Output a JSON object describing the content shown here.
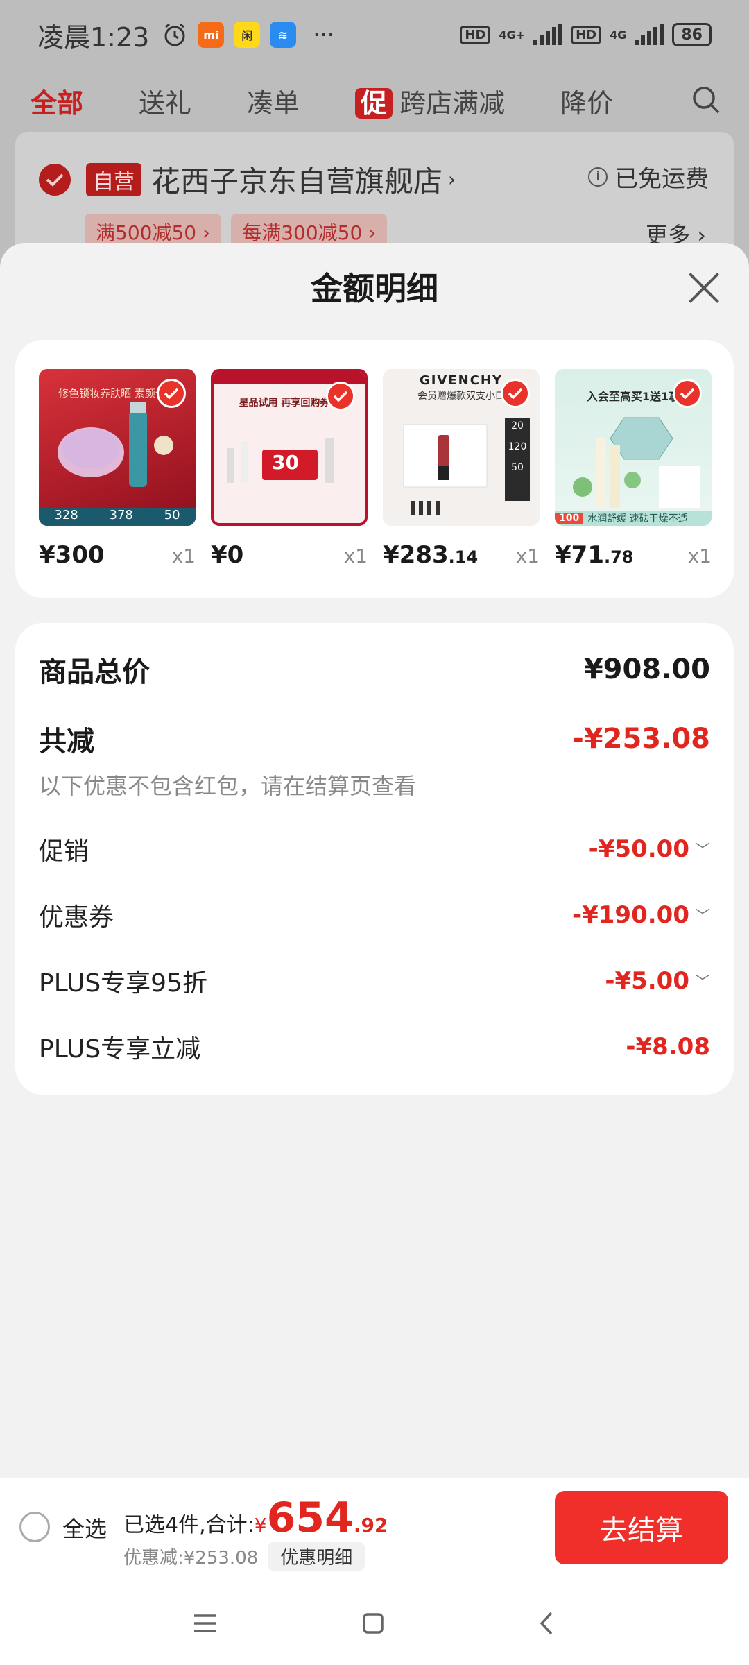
{
  "status_bar": {
    "time": "凌晨1:23",
    "apps": [
      "alarm-icon",
      "mi-app",
      "xianyu-app",
      "layers-app"
    ],
    "dots": "···",
    "net1": "4G+",
    "net2": "4G",
    "hd": "HD",
    "battery": "86"
  },
  "tabs": [
    {
      "label": "全部",
      "active": true
    },
    {
      "label": "送礼",
      "active": false
    },
    {
      "label": "凑单",
      "active": false
    },
    {
      "label": "跨店满减",
      "active": false,
      "tag": "促"
    },
    {
      "label": "降价",
      "active": false
    }
  ],
  "store": {
    "badge": "自营",
    "name": "花西子京东自营旗舰店",
    "shipping": "已免运费",
    "coupons": [
      "满500减50",
      "每满300减50"
    ],
    "more": "更多"
  },
  "sheet": {
    "title": "金额明细",
    "products": [
      {
        "price_int": "¥300",
        "price_dec": "",
        "qty": "x1",
        "banner": "修色锁妆养肤晒 素颜匀净",
        "prices": [
          "328",
          "378",
          "50"
        ]
      },
      {
        "price_int": "¥0",
        "price_dec": "",
        "qty": "x1",
        "banner": "星品试用 再享回购券补",
        "badge_value": "30"
      },
      {
        "price_int": "¥283",
        "price_dec": ".14",
        "qty": "x1",
        "brand": "GIVENCHY",
        "banner": "会员赠爆款双支小口",
        "tiers": [
          "20",
          "120",
          "50"
        ]
      },
      {
        "price_int": "¥71",
        "price_dec": ".78",
        "qty": "x1",
        "banner": "入会至高买1送1享",
        "footer": "水润舒缓 速砝干燥不适",
        "badge_value": "100"
      }
    ],
    "total_label": "商品总价",
    "total_value": "¥908.00",
    "reduce_label": "共减",
    "reduce_value": "-¥253.08",
    "note": "以下优惠不包含红包，请在结算页查看",
    "items": [
      {
        "label": "促销",
        "value": "-¥50.00",
        "expandable": true
      },
      {
        "label": "优惠券",
        "value": "-¥190.00",
        "expandable": true
      },
      {
        "label": "PLUS专享95折",
        "value": "-¥5.00",
        "expandable": true
      },
      {
        "label": "PLUS专享立减",
        "value": "-¥8.08",
        "expandable": false
      }
    ]
  },
  "checkout": {
    "select_all": "全选",
    "selected_text": "已选4件,合计:",
    "currency": "¥",
    "total_int": "654",
    "total_dec": ".92",
    "discount_text": "优惠减:¥253.08",
    "detail_button": "优惠明细",
    "pay_button": "去结算"
  },
  "colors": {
    "accent": "#e0261f",
    "pay_button": "#f12f2a"
  }
}
